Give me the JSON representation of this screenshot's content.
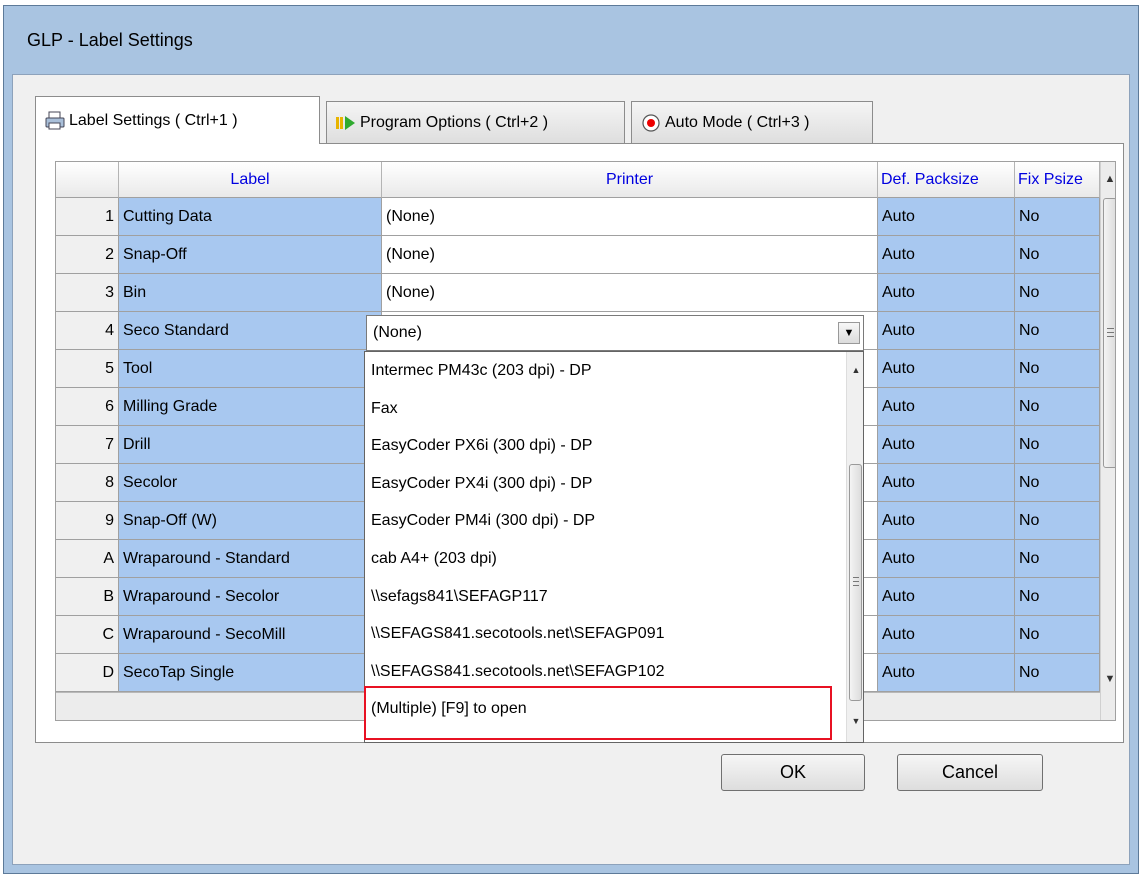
{
  "window": {
    "title": "GLP - Label Settings"
  },
  "tabs": [
    {
      "label": "Label Settings  ( Ctrl+1 )",
      "icon": "printer-icon",
      "active": true
    },
    {
      "label": "Program Options ( Ctrl+2 )",
      "icon": "play-icon",
      "active": false
    },
    {
      "label": "Auto Mode ( Ctrl+3 )",
      "icon": "record-icon",
      "active": false
    }
  ],
  "grid": {
    "columns": [
      "",
      "Label",
      "Printer",
      "Def. Packsize",
      "Fix Psize"
    ],
    "rows": [
      {
        "num": "1",
        "label": "Cutting Data",
        "printer": "(None)",
        "packsize": "Auto",
        "fix": "No"
      },
      {
        "num": "2",
        "label": "Snap-Off",
        "printer": "(None)",
        "packsize": "Auto",
        "fix": "No"
      },
      {
        "num": "3",
        "label": "Bin",
        "printer": "(None)",
        "packsize": "Auto",
        "fix": "No"
      },
      {
        "num": "4",
        "label": "Seco Standard",
        "printer": "(None)",
        "packsize": "Auto",
        "fix": "No"
      },
      {
        "num": "5",
        "label": "Tool",
        "printer": "",
        "packsize": "Auto",
        "fix": "No"
      },
      {
        "num": "6",
        "label": "Milling Grade",
        "printer": "",
        "packsize": "Auto",
        "fix": "No"
      },
      {
        "num": "7",
        "label": "Drill",
        "printer": "",
        "packsize": "Auto",
        "fix": "No"
      },
      {
        "num": "8",
        "label": "Secolor",
        "printer": "",
        "packsize": "Auto",
        "fix": "No"
      },
      {
        "num": "9",
        "label": "Snap-Off (W)",
        "printer": "",
        "packsize": "Auto",
        "fix": "No"
      },
      {
        "num": "A",
        "label": "Wraparound - Standard",
        "printer": "",
        "packsize": "Auto",
        "fix": "No"
      },
      {
        "num": "B",
        "label": "Wraparound - Secolor",
        "printer": "",
        "packsize": "Auto",
        "fix": "No"
      },
      {
        "num": "C",
        "label": "Wraparound - SecoMill",
        "printer": "",
        "packsize": "Auto",
        "fix": "No"
      },
      {
        "num": "D",
        "label": "SecoTap Single",
        "printer": "",
        "packsize": "Auto",
        "fix": "No"
      }
    ]
  },
  "dropdown": {
    "selected": "(None)",
    "options": [
      "Intermec PM43c (203 dpi) - DP",
      "Fax",
      "EasyCoder PX6i (300 dpi) - DP",
      "EasyCoder PX4i (300 dpi) - DP",
      "EasyCoder PM4i (300 dpi) - DP",
      "cab A4+ (203 dpi)",
      "\\\\sefags841\\SEFAGP117",
      "\\\\SEFAGS841.secotools.net\\SEFAGP091",
      "\\\\SEFAGS841.secotools.net\\SEFAGP102",
      "(Multiple) [F9] to open"
    ],
    "highlight_color": "#e81123"
  },
  "buttons": {
    "ok": "OK",
    "cancel": "Cancel"
  }
}
